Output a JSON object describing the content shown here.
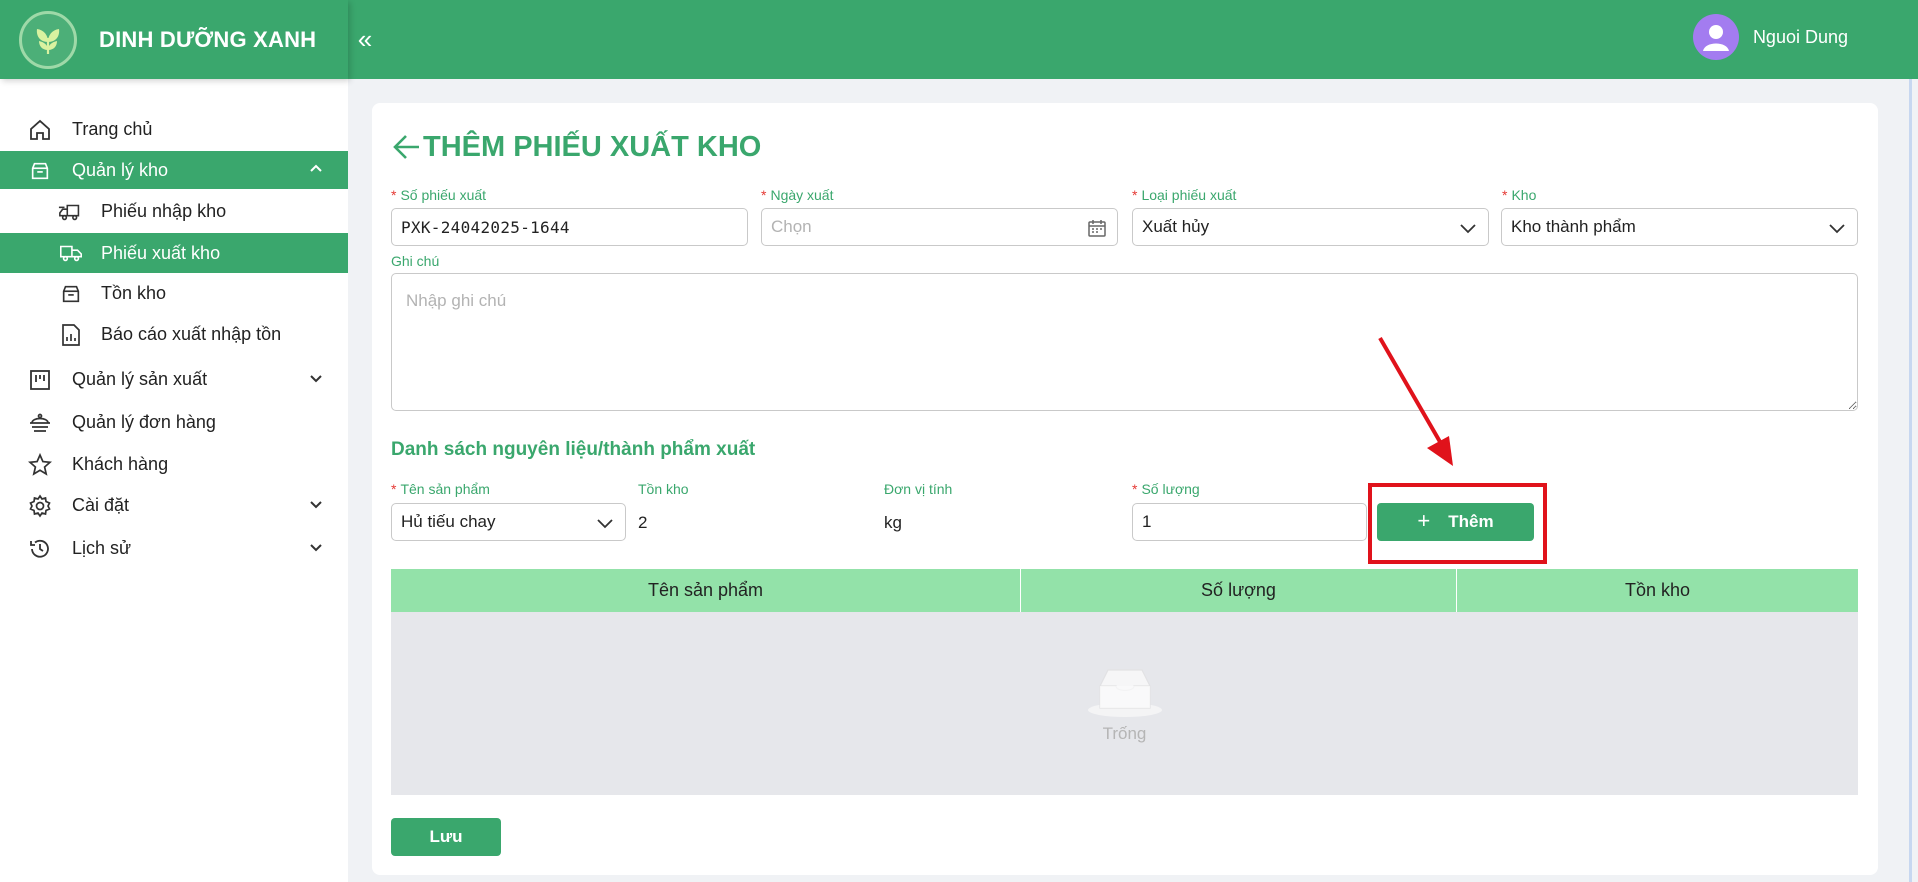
{
  "app": {
    "brand_name": "DINH DƯỠNG XANH",
    "accent": "#3aa76d",
    "header_accent": "#93e2a9"
  },
  "header": {
    "collapse_icon": "«",
    "user_name": "Nguoi Dung"
  },
  "sidebar": {
    "items": [
      {
        "label": "Trang chủ",
        "icon": "home-icon"
      },
      {
        "label": "Quản lý kho",
        "icon": "warehouse-icon",
        "expanded": true
      },
      {
        "label": "Phiếu nhập kho",
        "icon": "truck-in-icon"
      },
      {
        "label": "Phiếu xuất kho",
        "icon": "truck-out-icon",
        "active": true
      },
      {
        "label": "Tồn kho",
        "icon": "inbox-icon"
      },
      {
        "label": "Báo cáo xuất nhập tồn",
        "icon": "report-icon"
      },
      {
        "label": "Quản lý sản xuất",
        "icon": "production-icon"
      },
      {
        "label": "Quản lý đơn hàng",
        "icon": "order-icon"
      },
      {
        "label": "Khách hàng",
        "icon": "star-icon"
      },
      {
        "label": "Cài đặt",
        "icon": "gear-icon"
      },
      {
        "label": "Lịch sử",
        "icon": "history-icon"
      }
    ]
  },
  "form": {
    "title": "THÊM PHIẾU XUẤT KHO",
    "required_mark": "*",
    "so_phieu": {
      "label": "Số phiếu xuất",
      "value": "PXK-24042025-1644"
    },
    "ngay_xuat": {
      "label": "Ngày xuất",
      "placeholder": "Chọn"
    },
    "loai_phieu": {
      "label": "Loại phiếu xuất",
      "value": "Xuất hủy"
    },
    "kho": {
      "label": "Kho",
      "value": "Kho thành phẩm"
    },
    "ghi_chu": {
      "label": "Ghi chú",
      "placeholder": "Nhập ghi chú"
    }
  },
  "items_section": {
    "title": "Danh sách nguyên liệu/thành phẩm xuất",
    "product": {
      "label": "Tên sản phẩm",
      "value": "Hủ tiếu chay"
    },
    "stock": {
      "label": "Tồn kho",
      "value": "2"
    },
    "unit": {
      "label": "Đơn vị tính",
      "value": "kg"
    },
    "quantity": {
      "label": "Số lượng",
      "value": "1"
    },
    "add_button": {
      "label": "Thêm",
      "icon": "plus-icon"
    }
  },
  "table": {
    "columns": [
      "Tên sản phẩm",
      "Số lượng",
      "Tồn kho"
    ],
    "rows": [],
    "empty_text": "Trống"
  },
  "actions": {
    "save_label": "Lưu"
  },
  "annotation": {
    "color": "#e0121b"
  }
}
